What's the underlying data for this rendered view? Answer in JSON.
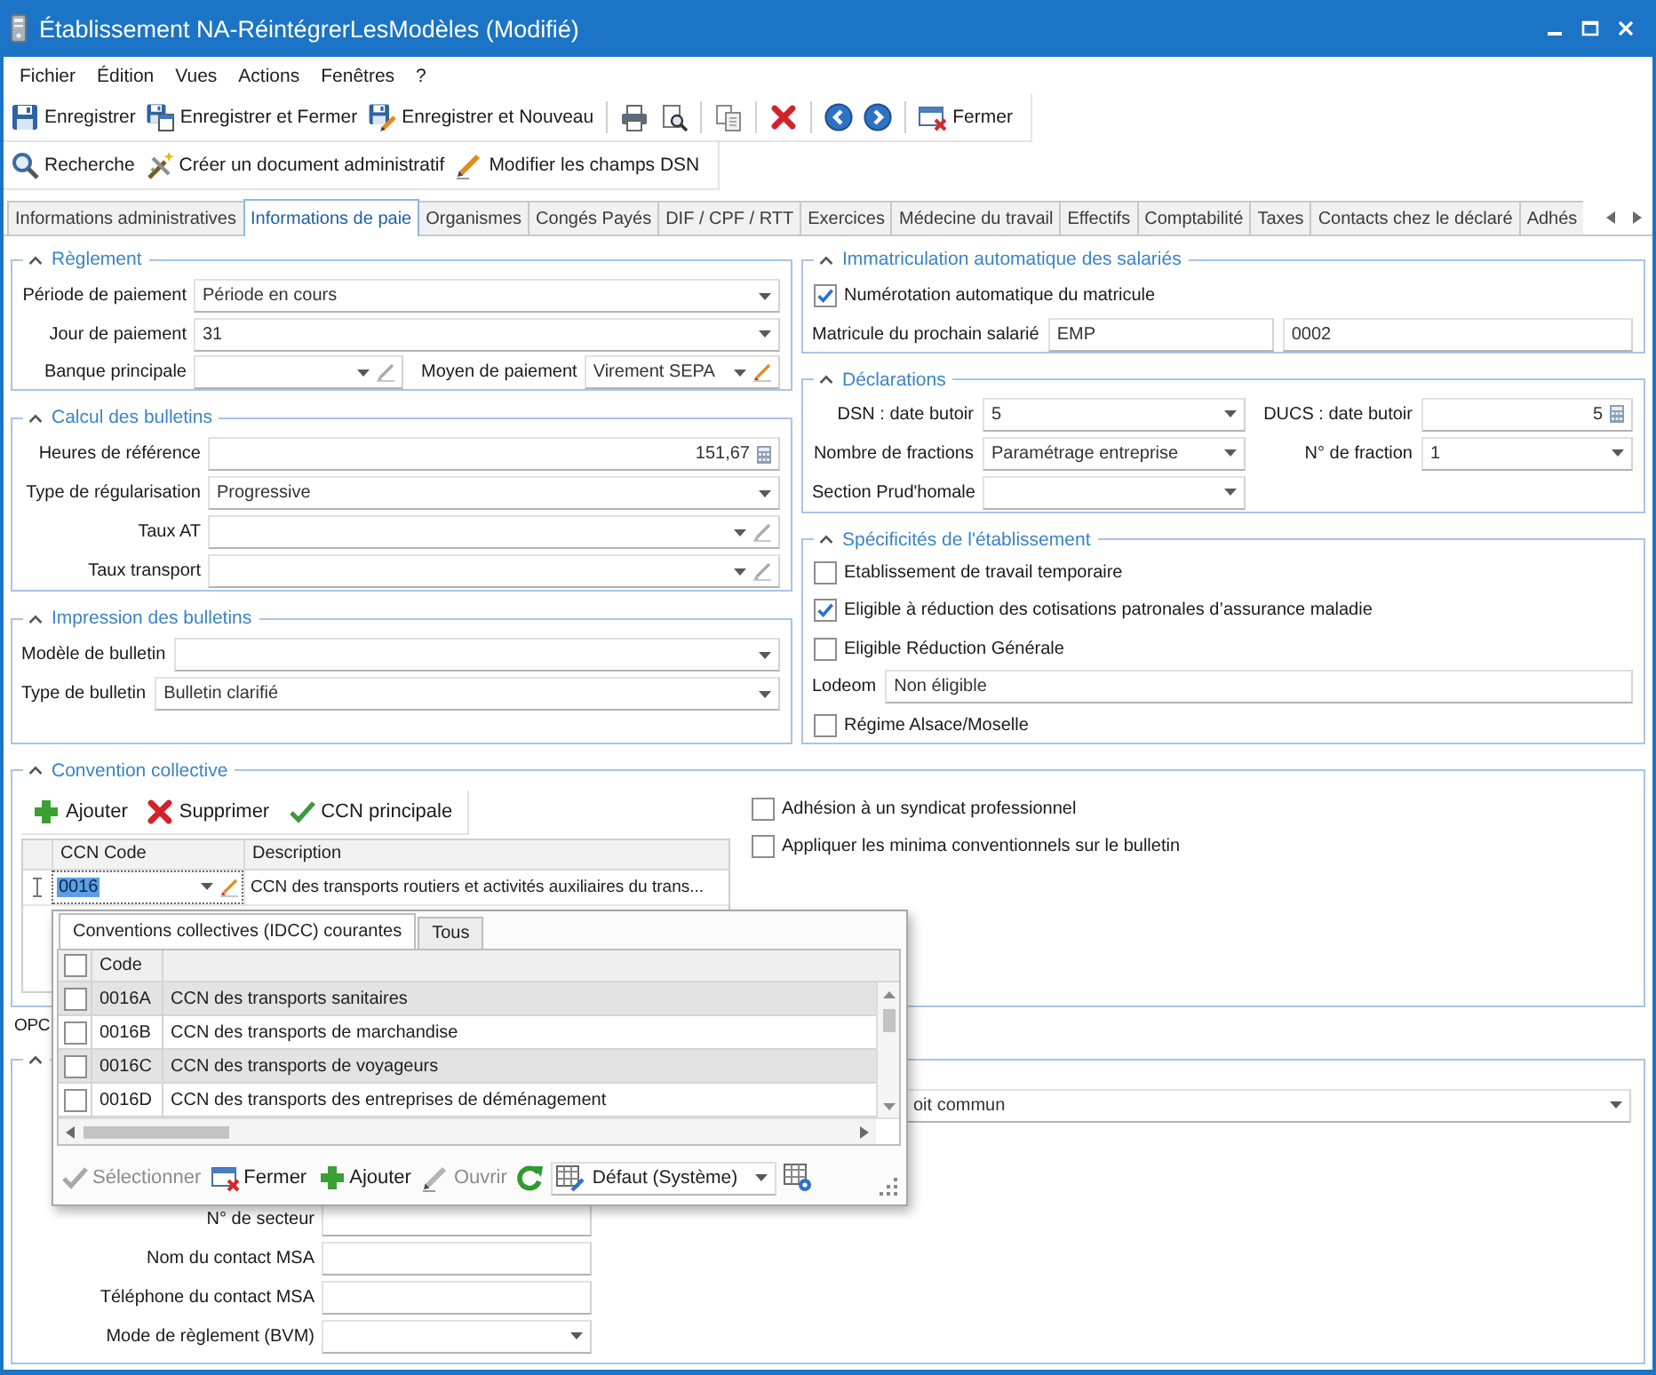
{
  "window": {
    "title": "Établissement NA-RéintégrerLesModèles (Modifié)"
  },
  "menu": [
    "Fichier",
    "Édition",
    "Vues",
    "Actions",
    "Fenêtres",
    "?"
  ],
  "toolbar": {
    "save": "Enregistrer",
    "save_close": "Enregistrer et Fermer",
    "save_new": "Enregistrer et Nouveau",
    "close": "Fermer"
  },
  "actions": {
    "search": "Recherche",
    "create_document": "Créer un document administratif",
    "edit_dsn": "Modifier les champs DSN"
  },
  "tabs": [
    {
      "label": "Informations administratives",
      "selected": false
    },
    {
      "label": "Informations de paie",
      "selected": true
    },
    {
      "label": "Organismes",
      "selected": false
    },
    {
      "label": "Congés Payés",
      "selected": false
    },
    {
      "label": "DIF / CPF / RTT",
      "selected": false
    },
    {
      "label": "Exercices",
      "selected": false
    },
    {
      "label": "Médecine du travail",
      "selected": false
    },
    {
      "label": "Effectifs",
      "selected": false
    },
    {
      "label": "Comptabilité",
      "selected": false
    },
    {
      "label": "Taxes",
      "selected": false
    },
    {
      "label": "Contacts chez le déclaré",
      "selected": false
    },
    {
      "label": "Adhés",
      "selected": false
    }
  ],
  "reglement": {
    "title": "Règlement",
    "expanded": true,
    "rows": [
      [
        {
          "kind": "combo",
          "label": "Période de paiement",
          "value": "Période en cours"
        }
      ],
      [
        {
          "kind": "combo",
          "label": "Jour de paiement",
          "value": "31"
        }
      ],
      [
        {
          "kind": "combo_edit",
          "label": "Banque principale",
          "edit_enabled": false
        },
        {
          "kind": "combo_edit",
          "label": "Moyen de paiement",
          "value": "Virement SEPA",
          "edit_enabled": true
        }
      ]
    ]
  },
  "calcul": {
    "title": "Calcul des bulletins",
    "expanded": true,
    "rows": [
      [
        {
          "kind": "number",
          "label": "Heures de référence",
          "value": "151,67"
        }
      ],
      [
        {
          "kind": "combo",
          "label": "Type de régularisation",
          "value": "Progressive"
        }
      ],
      [
        {
          "kind": "combo_edit",
          "label": "Taux AT",
          "edit_enabled": false
        }
      ],
      [
        {
          "kind": "combo_edit",
          "label": "Taux transport",
          "edit_enabled": false
        }
      ]
    ]
  },
  "impression": {
    "title": "Impression des bulletins",
    "expanded": true,
    "rows": [
      [
        {
          "kind": "combo",
          "label": "Modèle de bulletin"
        }
      ],
      [
        {
          "kind": "combo",
          "label": "Type de bulletin",
          "value": "Bulletin clarifié"
        }
      ]
    ]
  },
  "immatriculation": {
    "title": "Immatriculation automatique des salariés",
    "expanded": true,
    "auto_number": {
      "label": "Numérotation automatique du matricule",
      "checked": true
    },
    "next_number": {
      "label": "Matricule du prochain salarié",
      "prefix": "EMP",
      "number": "0002"
    }
  },
  "declarations": {
    "title": "Déclarations",
    "expanded": true,
    "fields": [
      {
        "kind": "combo",
        "label": "DSN : date butoir",
        "value": "5"
      },
      {
        "kind": "number",
        "label": "DUCS : date butoir",
        "value": "5"
      },
      {
        "kind": "combo",
        "label": "Nombre de fractions",
        "value": "Paramétrage entreprise"
      },
      {
        "kind": "combo",
        "label": "N° de fraction",
        "value": "1"
      },
      {
        "kind": "combo",
        "label": "Section Prud'homale"
      }
    ]
  },
  "specificites": {
    "title": "Spécificités de l'établissement",
    "expanded": true,
    "items": [
      {
        "kind": "checkbox",
        "label": "Etablissement de travail temporaire",
        "checked": false
      },
      {
        "kind": "checkbox",
        "label": "Eligible à réduction des cotisations patronales d’assurance maladie",
        "checked": true
      },
      {
        "kind": "checkbox",
        "label": "Eligible Réduction Générale",
        "checked": false
      },
      {
        "kind": "text",
        "label": "Lodeom",
        "value": "Non éligible"
      },
      {
        "kind": "checkbox",
        "label": "Régime Alsace/Moselle",
        "checked": false
      }
    ]
  },
  "convention": {
    "title": "Convention collective",
    "expanded": true,
    "toolbar": [
      "Ajouter",
      "Supprimer",
      "CCN principale"
    ],
    "columns": [
      "CCN Code",
      "Description"
    ],
    "row": {
      "code": "0016",
      "description": "CCN des transports routiers et activités auxiliaires du trans..."
    },
    "options": [
      {
        "label": "Adhésion à un syndicat professionnel",
        "checked": false
      },
      {
        "label": "Appliquer les minima conventionnels sur le bulletin",
        "checked": false
      }
    ]
  },
  "partial_label": "OPC",
  "bottom_group": {
    "expanded": true,
    "combo": {
      "kind": "combo",
      "value": "oit commun"
    },
    "fields": [
      {
        "kind": "text",
        "label": "N° de secteur"
      },
      {
        "kind": "text",
        "label": "Nom du contact MSA"
      },
      {
        "kind": "text",
        "label": "Téléphone du contact MSA"
      },
      {
        "kind": "combo",
        "label": "Mode de règlement (BVM)"
      }
    ]
  },
  "lookup_popup": {
    "tabs": [
      {
        "label": "Conventions collectives (IDCC) courantes",
        "selected": true
      },
      {
        "label": "Tous",
        "selected": false
      }
    ],
    "header": {
      "checked": false,
      "code": "Code"
    },
    "rows": [
      {
        "checked": false,
        "code": "0016A",
        "description": "CCN des transports sanitaires"
      },
      {
        "checked": false,
        "code": "0016B",
        "description": "CCN des transports de marchandise"
      },
      {
        "checked": false,
        "code": "0016C",
        "description": "CCN des transports de voyageurs"
      },
      {
        "checked": false,
        "code": "0016D",
        "description": "CCN des transports des entreprises de déménagement"
      }
    ],
    "buttons": [
      {
        "label": "Sélectionner",
        "disabled": true
      },
      {
        "label": "Fermer",
        "disabled": false
      },
      {
        "label": "Ajouter",
        "disabled": false
      },
      {
        "label": "Ouvrir",
        "disabled": true
      }
    ],
    "layout_select": "Défaut (Système)"
  }
}
